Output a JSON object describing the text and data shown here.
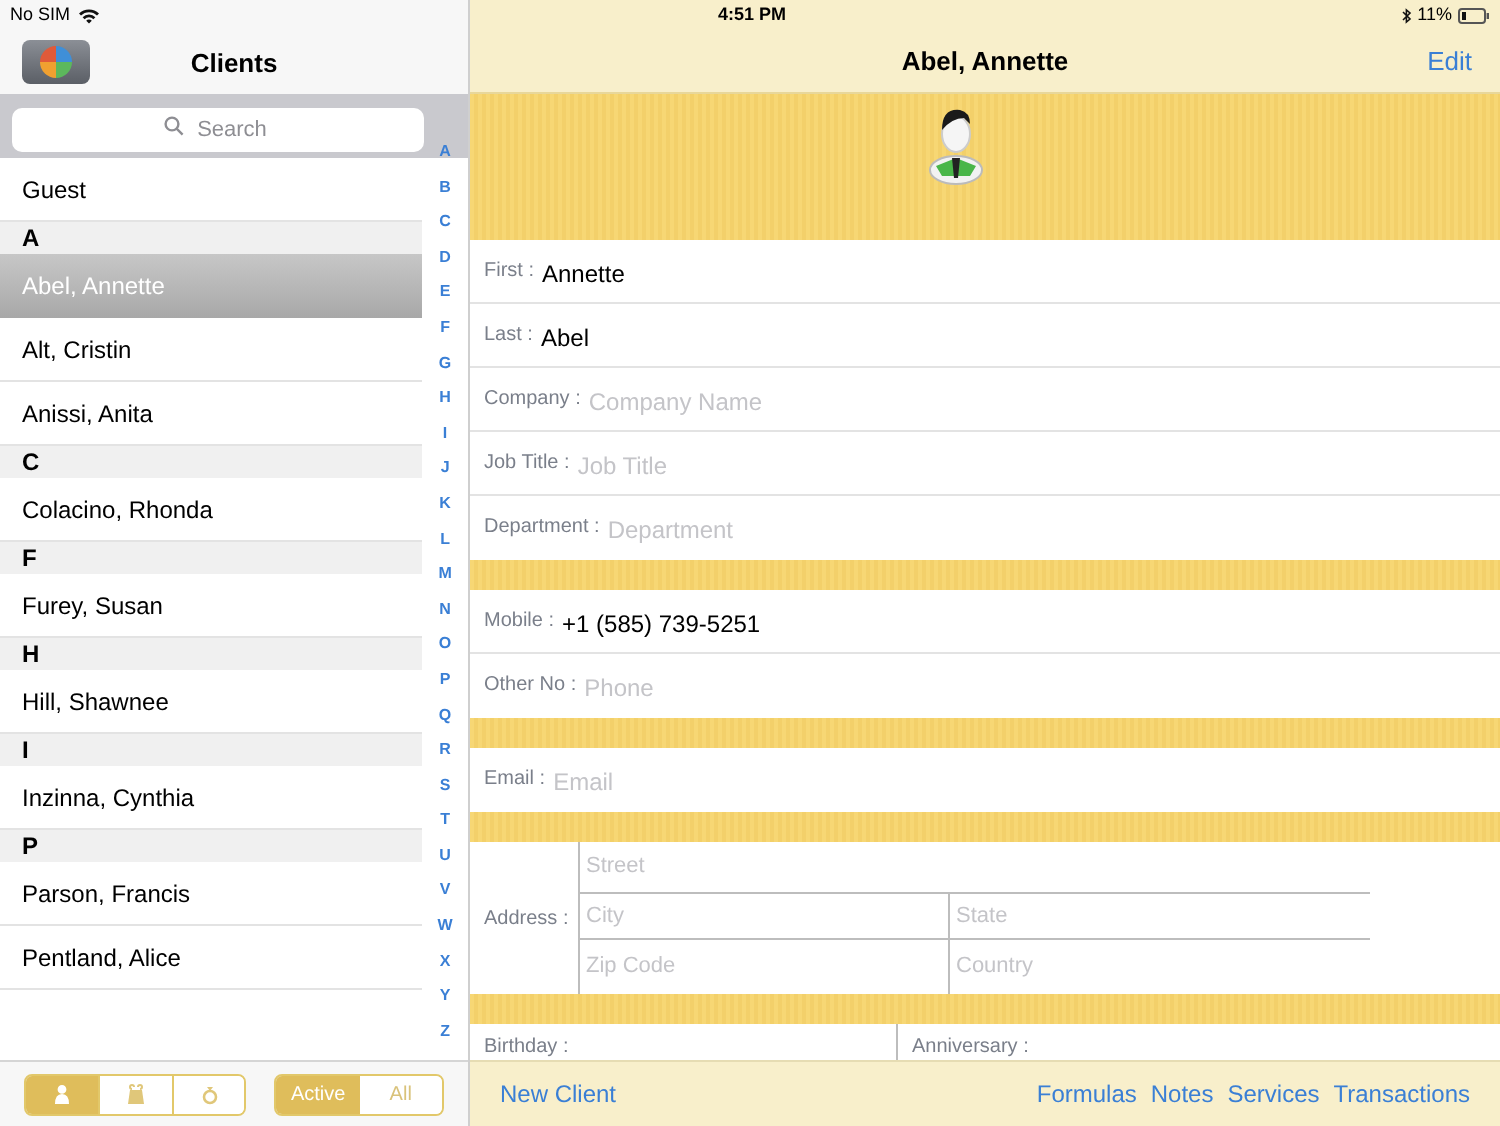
{
  "status_bar": {
    "carrier": "No SIM",
    "time": "4:51 PM",
    "battery": "11%"
  },
  "sidebar": {
    "title": "Clients",
    "search": {
      "placeholder": "Search"
    },
    "items": [
      {
        "kind": "row",
        "label": "Guest",
        "selected": false
      },
      {
        "kind": "header",
        "label": "A"
      },
      {
        "kind": "row",
        "label": "Abel, Annette",
        "selected": true
      },
      {
        "kind": "row",
        "label": "Alt, Cristin",
        "selected": false
      },
      {
        "kind": "row",
        "label": "Anissi, Anita",
        "selected": false
      },
      {
        "kind": "header",
        "label": "C"
      },
      {
        "kind": "row",
        "label": "Colacino, Rhonda",
        "selected": false
      },
      {
        "kind": "header",
        "label": "F"
      },
      {
        "kind": "row",
        "label": "Furey, Susan",
        "selected": false
      },
      {
        "kind": "header",
        "label": "H"
      },
      {
        "kind": "row",
        "label": "Hill, Shawnee",
        "selected": false
      },
      {
        "kind": "header",
        "label": "I"
      },
      {
        "kind": "row",
        "label": "Inzinna, Cynthia",
        "selected": false
      },
      {
        "kind": "header",
        "label": "P"
      },
      {
        "kind": "row",
        "label": "Parson, Francis",
        "selected": false
      },
      {
        "kind": "row",
        "label": "Pentland, Alice",
        "selected": false
      }
    ],
    "index": [
      "A",
      "B",
      "C",
      "D",
      "E",
      "F",
      "G",
      "H",
      "I",
      "J",
      "K",
      "L",
      "M",
      "N",
      "O",
      "P",
      "Q",
      "R",
      "S",
      "T",
      "U",
      "V",
      "W",
      "X",
      "Y",
      "Z"
    ],
    "type_tabs": [
      {
        "kind": "person",
        "selected": true
      },
      {
        "kind": "bag",
        "selected": false
      },
      {
        "kind": "ring",
        "selected": false
      }
    ],
    "filter_tabs": [
      {
        "label": "Active",
        "selected": true
      },
      {
        "label": "All",
        "selected": false
      }
    ]
  },
  "detail": {
    "title": "Abel, Annette",
    "edit": "Edit",
    "sections": [
      {
        "kind": "fields",
        "fields": [
          {
            "label": "First :",
            "value": "Annette"
          },
          {
            "label": "Last :",
            "value": "Abel"
          },
          {
            "label": "Company :",
            "placeholder": "Company Name"
          },
          {
            "label": "Job Title :",
            "placeholder": "Job Title"
          },
          {
            "label": "Department :",
            "placeholder": "Department"
          }
        ]
      },
      {
        "kind": "fields",
        "fields": [
          {
            "label": "Mobile :",
            "value": "+1 (585) 739-5251"
          },
          {
            "label": "Other No :",
            "placeholder": "Phone"
          }
        ]
      },
      {
        "kind": "fields",
        "fields": [
          {
            "label": "Email :",
            "placeholder": "Email"
          }
        ]
      },
      {
        "kind": "address",
        "label": "Address :",
        "parts": [
          {
            "placeholder": "Street"
          },
          {
            "placeholder": "City"
          },
          {
            "placeholder": "State"
          },
          {
            "placeholder": "Zip Code"
          },
          {
            "placeholder": "Country"
          }
        ]
      },
      {
        "kind": "dates",
        "labels": [
          "Birthday :",
          "Anniversary :"
        ]
      }
    ]
  },
  "toolbar": {
    "new_client": "New Client",
    "links": [
      "Formulas",
      "Notes",
      "Services",
      "Transactions"
    ]
  }
}
